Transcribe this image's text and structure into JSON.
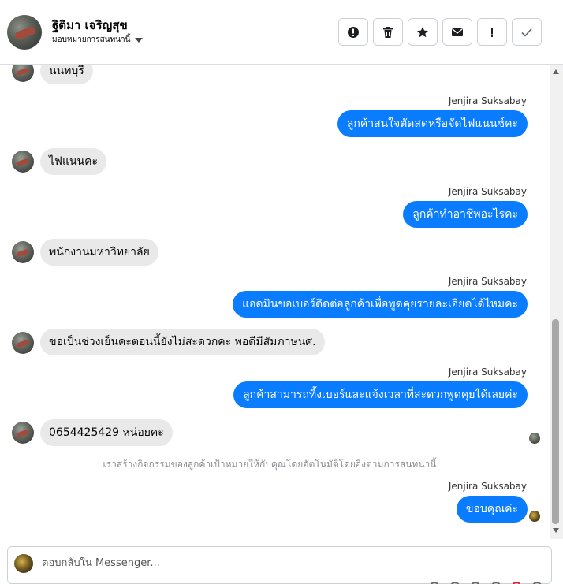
{
  "header": {
    "contact_name": "ฐิติมา เจริญสุข",
    "assign_label": "มอบหมายการสนทนานี้",
    "actions": [
      {
        "name": "mark-spam",
        "icon": "alert-circle-icon"
      },
      {
        "name": "delete",
        "icon": "trash-icon"
      },
      {
        "name": "star",
        "icon": "star-icon"
      },
      {
        "name": "mark-unread",
        "icon": "envelope-icon"
      },
      {
        "name": "follow-up",
        "icon": "exclamation-icon"
      },
      {
        "name": "mark-done",
        "icon": "check-icon"
      }
    ]
  },
  "messages": [
    {
      "from": "customer",
      "text": "นนทบุรี"
    },
    {
      "from": "agent",
      "sender": "Jenjira Suksabay",
      "text": "ลูกค้าสนใจตัดสดหรือจัดไฟแนนซ์คะ"
    },
    {
      "from": "customer",
      "text": "ไฟแนนคะ"
    },
    {
      "from": "agent",
      "sender": "Jenjira Suksabay",
      "text": "ลูกค้าทำอาชีพอะไรคะ"
    },
    {
      "from": "customer",
      "text": "พนักงานมหาวิทยาลัย"
    },
    {
      "from": "agent",
      "sender": "Jenjira Suksabay",
      "text": "แอดมินขอเบอร์ติดต่อลูกค้าเพื่อพูดคุยรายละเอียดได้ไหมคะ"
    },
    {
      "from": "customer",
      "text": "ขอเป็นช่วงเย็นคะตอนนี้ยังไม่สะดวกคะ พอดีมีสัมภาษนศ."
    },
    {
      "from": "agent",
      "sender": "Jenjira Suksabay",
      "text": "ลูกค้าสามารถทิ้งเบอร์และแจ้งเวลาที่สะดวกพูดคุยได้เลยค่ะ"
    },
    {
      "from": "customer",
      "text": "0654425429 หน่อยคะ"
    },
    {
      "from": "system",
      "text": "เราสร้างกิจกรรมของลูกค้าเป้าหมายให้กับคุณโดยอัตโนมัติโดยอิงตามการสนทนานี้"
    },
    {
      "from": "agent",
      "sender": "Jenjira Suksabay",
      "text": "ขอบคุณค่ะ"
    }
  ],
  "composer": {
    "placeholder": "ตอบกลับใน Messenger..."
  },
  "colors": {
    "outgoing_bubble": "#0a7cff",
    "incoming_bubble": "#e9e9e9"
  }
}
